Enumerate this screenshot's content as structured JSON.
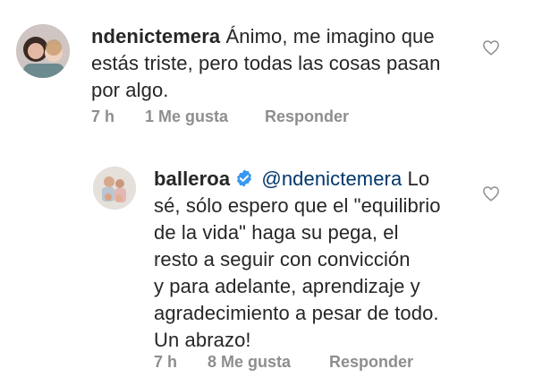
{
  "comments": [
    {
      "username": "ndenictemera",
      "text": "Ánimo, me imagino que\nestás triste, pero todas las cosas pasan\npor algo.",
      "time": "7 h",
      "likes": "1 Me gusta",
      "reply": "Responder",
      "avatar_icon": "user-avatar-photo",
      "heart_icon": "heart-outline-icon"
    },
    {
      "username": "balleroa",
      "verified": true,
      "mention": "@ndenictemera",
      "first_line_rest": "Lo",
      "text": "sé, sólo espero que el \"equilibrio\nde la vida\" haga su pega, el\nresto a seguir con convicción\ny para adelante, aprendizaje y\nagradecimiento a pesar de todo.\nUn abrazo!",
      "time": "7 h",
      "likes": "8 Me gusta",
      "reply": "Responder",
      "avatar_icon": "user-avatar-photo",
      "heart_icon": "heart-outline-icon"
    }
  ],
  "colors": {
    "text": "#262626",
    "meta": "#8e8e8e",
    "mention": "#00376b",
    "verified": "#3897f0"
  }
}
